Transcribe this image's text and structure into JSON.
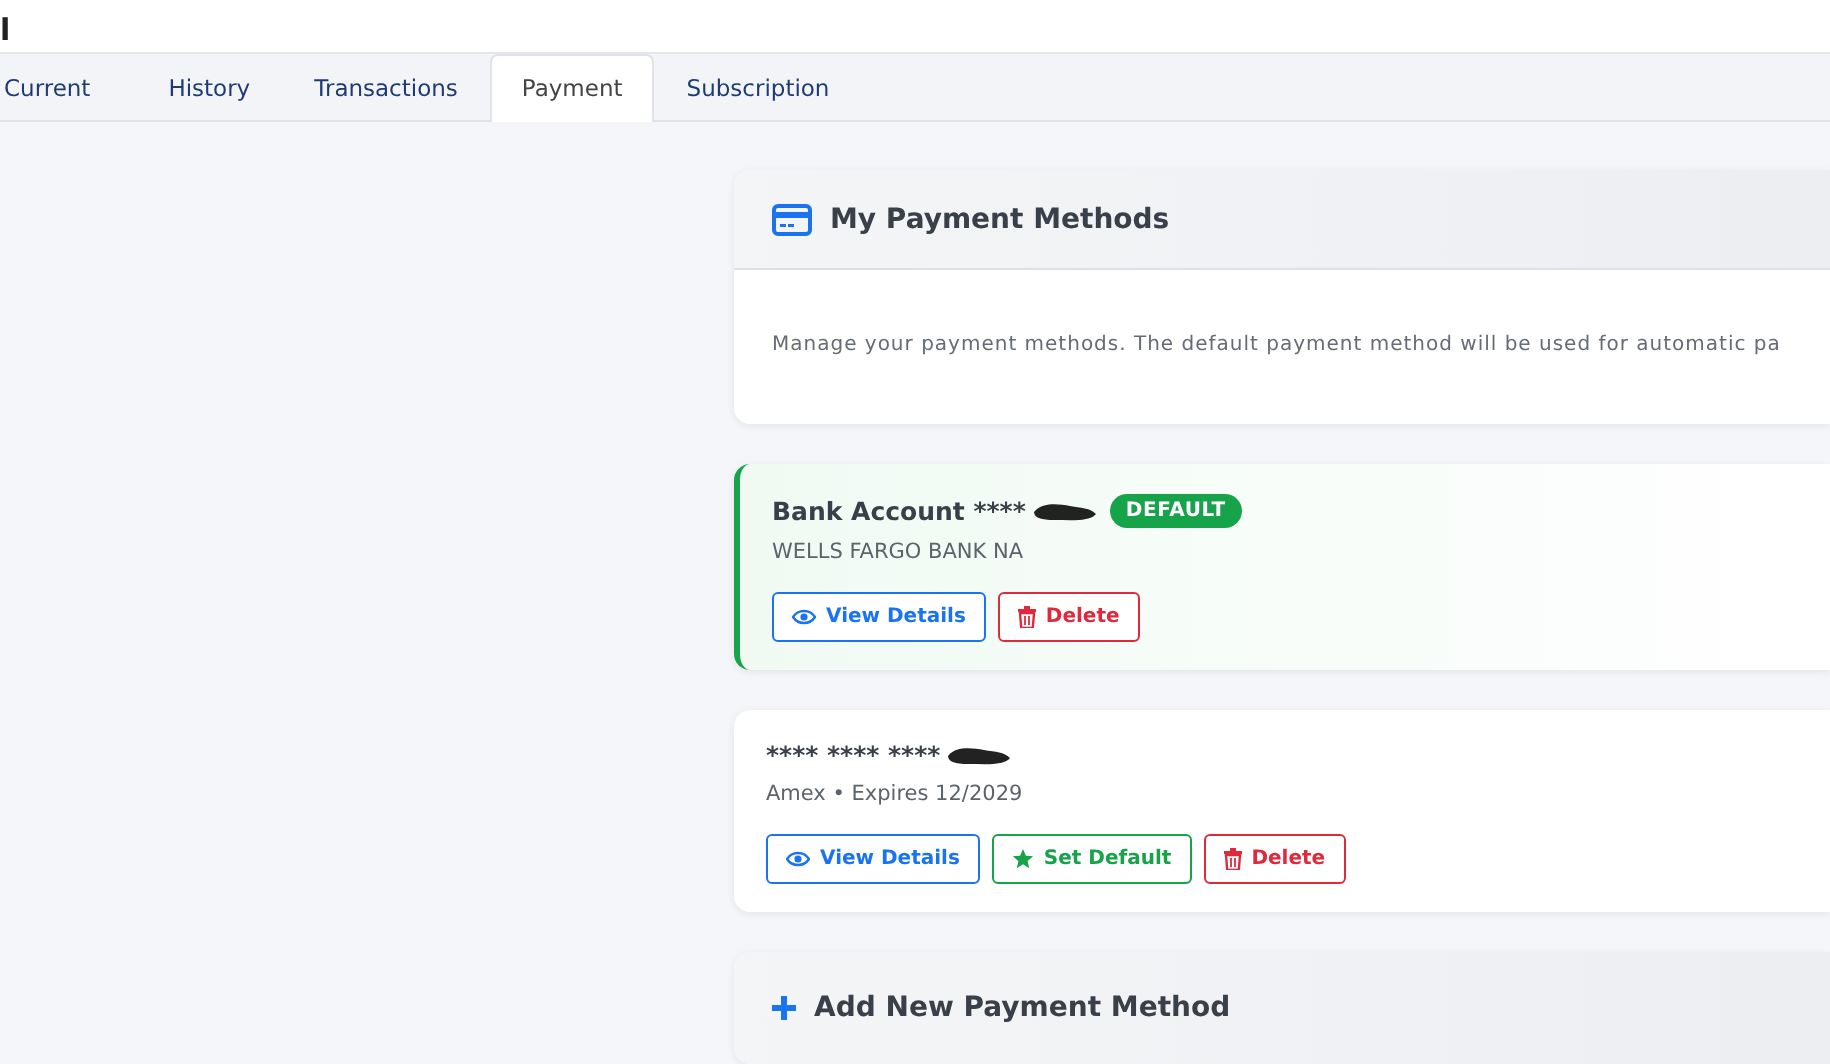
{
  "header": {
    "title": "l"
  },
  "tabs": [
    {
      "label": "Current",
      "selected": false
    },
    {
      "label": "History",
      "selected": false
    },
    {
      "label": "Transactions",
      "selected": false
    },
    {
      "label": "Payment",
      "selected": true
    },
    {
      "label": "Subscription",
      "selected": false
    }
  ],
  "intro_card": {
    "title": "My Payment Methods",
    "description": "Manage your payment methods. The default payment method will be used for automatic pa"
  },
  "methods": [
    {
      "title": "Bank Account ****",
      "redacted": true,
      "default": true,
      "badge": "DEFAULT",
      "subtitle": "WELLS FARGO BANK NA",
      "buttons": [
        {
          "kind": "view",
          "label": "View Details"
        },
        {
          "kind": "delete",
          "label": "Delete"
        }
      ]
    },
    {
      "title": "**** **** ****",
      "redacted": true,
      "default": false,
      "subtitle": "Amex • Expires 12/2029",
      "buttons": [
        {
          "kind": "view",
          "label": "View Details"
        },
        {
          "kind": "set_default",
          "label": "Set Default"
        },
        {
          "kind": "delete",
          "label": "Delete"
        }
      ]
    }
  ],
  "add_card": {
    "title": "Add New Payment Method"
  }
}
